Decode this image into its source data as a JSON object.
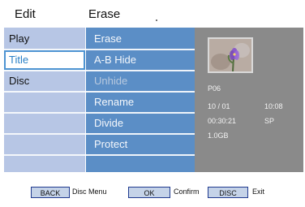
{
  "header": {
    "left_title": "Edit",
    "right_title": "Erase"
  },
  "left_menu": [
    {
      "label": "Play",
      "selected": false
    },
    {
      "label": "Title",
      "selected": true
    },
    {
      "label": "Disc",
      "selected": false
    },
    {
      "label": "",
      "selected": false
    },
    {
      "label": "",
      "selected": false
    },
    {
      "label": "",
      "selected": false
    },
    {
      "label": "",
      "selected": false
    }
  ],
  "submenu": [
    {
      "label": "Erase",
      "enabled": true
    },
    {
      "label": "A-B Hide",
      "enabled": true
    },
    {
      "label": "Unhide",
      "enabled": false
    },
    {
      "label": "Rename",
      "enabled": true
    },
    {
      "label": "Divide",
      "enabled": true
    },
    {
      "label": "Protect",
      "enabled": true
    }
  ],
  "info": {
    "program": "P06",
    "date": "10 / 01",
    "time": "10:08",
    "duration": "00:30:21",
    "quality": "SP",
    "size": "1.0GB"
  },
  "footer": {
    "back_button": "BACK",
    "back_label": "Disc Menu",
    "ok_button": "OK",
    "ok_label": "Confirm",
    "disc_button": "DISC",
    "disc_label": "Exit"
  }
}
